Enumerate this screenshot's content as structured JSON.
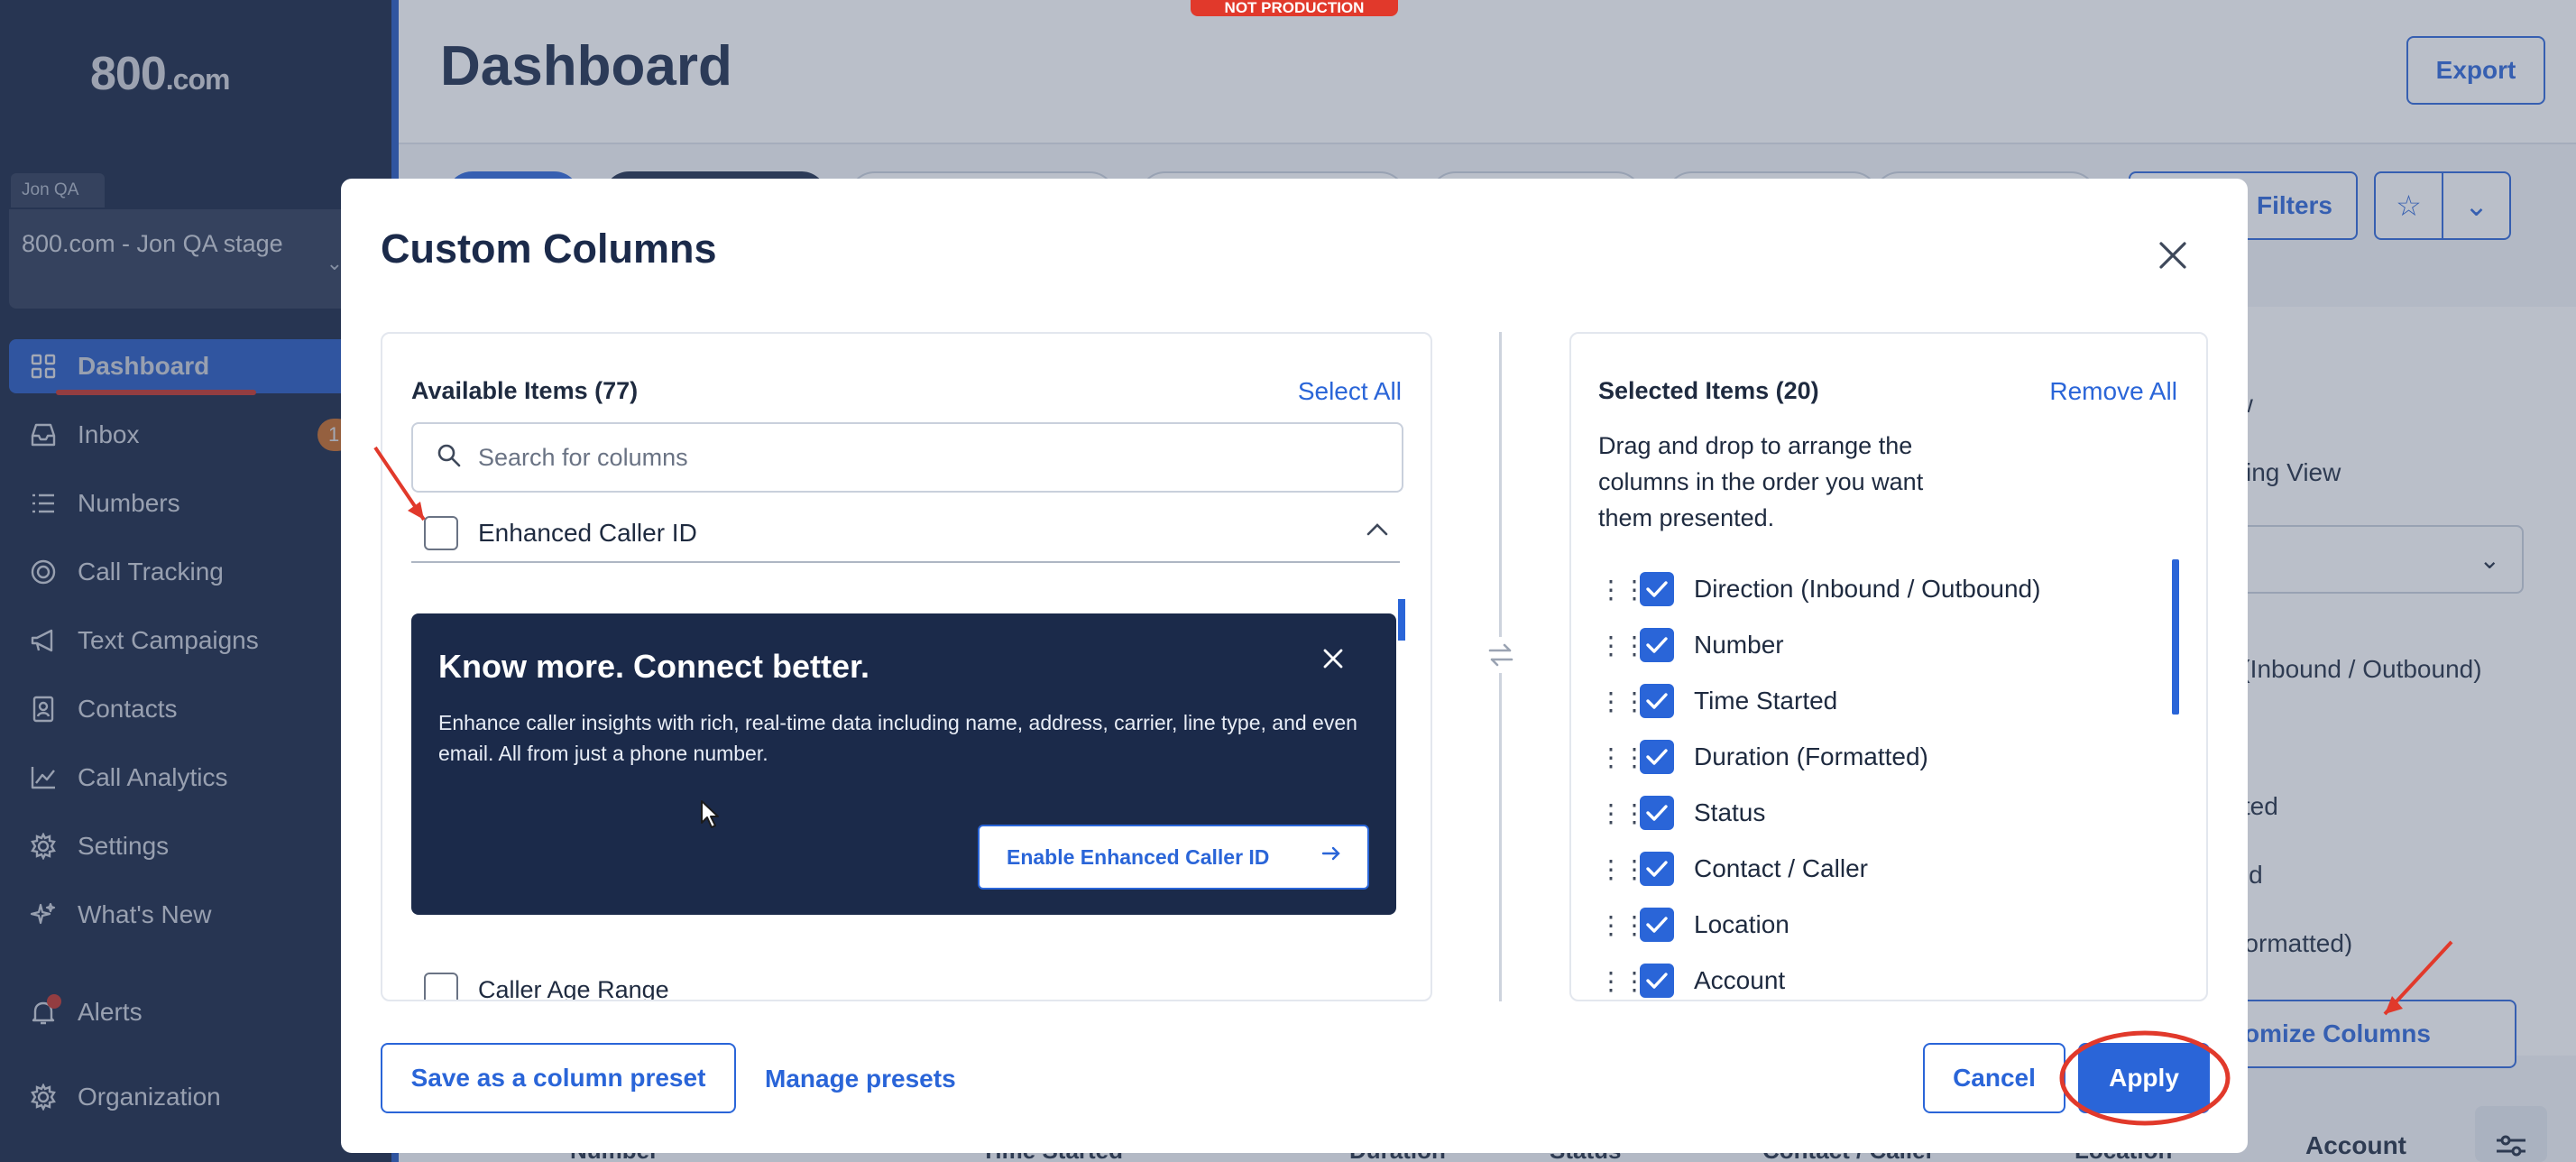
{
  "banner": "NOT PRODUCTION",
  "sidebar": {
    "logo_main": "800",
    "logo_suffix": ".com",
    "org_tag": "Jon QA",
    "org_name": "800.com - Jon QA stage",
    "items": [
      {
        "label": "Dashboard",
        "icon": "grid-icon"
      },
      {
        "label": "Inbox",
        "icon": "inbox-icon",
        "badge": "1"
      },
      {
        "label": "Numbers",
        "icon": "list-icon"
      },
      {
        "label": "Call Tracking",
        "icon": "target-icon"
      },
      {
        "label": "Text Campaigns",
        "icon": "megaphone-icon"
      },
      {
        "label": "Contacts",
        "icon": "contacts-icon"
      },
      {
        "label": "Call Analytics",
        "icon": "chart-line-icon"
      },
      {
        "label": "Settings",
        "icon": "gear-icon"
      },
      {
        "label": "What's New",
        "icon": "sparkle-icon"
      },
      {
        "label": "Alerts",
        "icon": "bell-icon"
      },
      {
        "label": "Organization",
        "icon": "gear-icon"
      }
    ]
  },
  "header": {
    "title": "Dashboard",
    "export_label": "Export",
    "filters_label": "Filters"
  },
  "background": {
    "view_1": "ew",
    "view_2": "cking View",
    "select_value": "n",
    "col_1": "n (Inbound / Outbound)",
    "col_2": "arted",
    "col_3": "ded",
    "col_4": "(Formatted)",
    "customize_label": "omize Columns",
    "table_heads": [
      "Number",
      "Time Started",
      "Duration",
      "Status",
      "Contact / Caller",
      "Location"
    ],
    "account_head": "Account"
  },
  "modal": {
    "title": "Custom Columns",
    "available": {
      "heading": "Available Items (77)",
      "select_all": "Select All",
      "search_placeholder": "Search for columns",
      "search_value": "",
      "enhanced_caller_id": "Enhanced Caller ID",
      "partial_item": "Caller Age Range"
    },
    "promo": {
      "title": "Know more. Connect better.",
      "body": "Enhance caller insights with rich, real-time data including name, address, carrier, line type, and even email. All from just a phone number.",
      "button": "Enable Enhanced Caller ID"
    },
    "selected": {
      "heading": "Selected Items (20)",
      "remove_all": "Remove All",
      "help": "Drag and drop to arrange the columns in the order you want them presented.",
      "items": [
        "Direction (Inbound / Outbound)",
        "Number",
        "Time Started",
        "Duration (Formatted)",
        "Status",
        "Contact / Caller",
        "Location",
        "Account"
      ]
    },
    "footer": {
      "save_preset": "Save as a column preset",
      "manage_presets": "Manage presets",
      "cancel": "Cancel",
      "apply": "Apply"
    }
  },
  "colors": {
    "sidebar_bg": "#1b2a4a",
    "accent": "#2a65d8",
    "annotation": "#e1392b",
    "promo_bg": "#1b2a4a"
  }
}
